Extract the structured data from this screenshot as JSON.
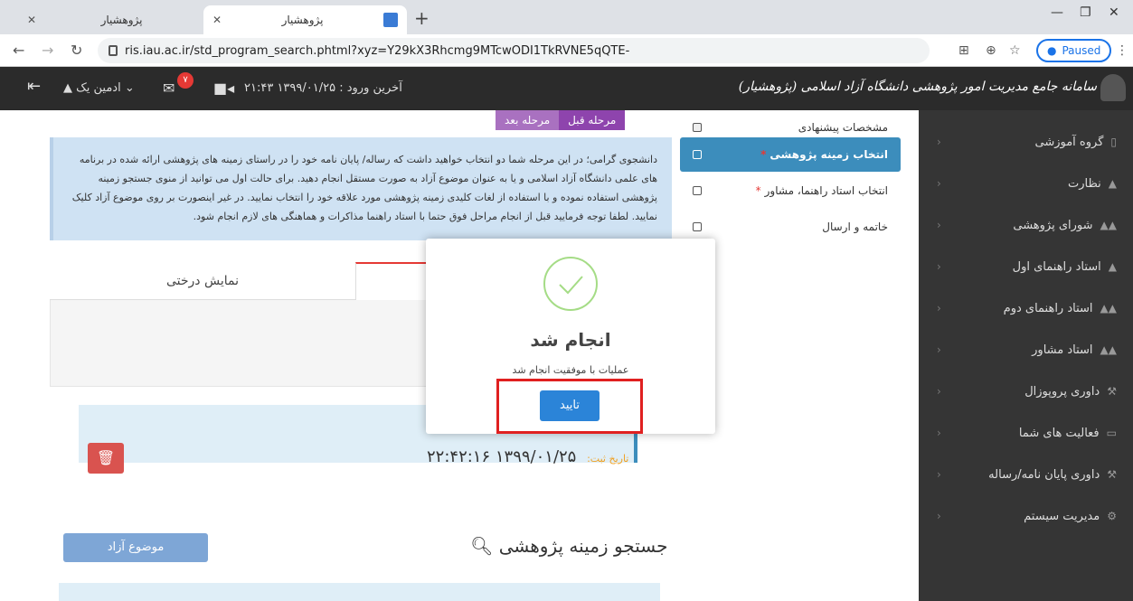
{
  "browser": {
    "tabs": [
      {
        "title": "پژوهشیار",
        "active": false
      },
      {
        "title": "پژوهشیار",
        "active": true
      }
    ],
    "url": "ris.iau.ac.ir/std_program_search.phtml?xyz=Y29kX3Rhcmg9MTcwODI1TkRVNE5qQTE-",
    "paused_label": "Paused"
  },
  "header": {
    "system_title": "سامانه جامع مدیریت امور پژوهشی دانشگاه آزاد اسلامی (پژوهشیار)",
    "last_login": "آخرین ورود : ۱۳۹۹/۰۱/۲۵ ۲۱:۴۳",
    "user_name": "ادمین یک",
    "notification_count": "۷"
  },
  "sidebar": {
    "items": [
      {
        "label": "گروه آموزشی",
        "icon": "file-icon"
      },
      {
        "label": "نظارت",
        "icon": "user-icon"
      },
      {
        "label": "شورای پژوهشی",
        "icon": "users-icon"
      },
      {
        "label": "استاد راهنمای اول",
        "icon": "user-icon"
      },
      {
        "label": "استاد راهنمای دوم",
        "icon": "users-icon"
      },
      {
        "label": "استاد مشاور",
        "icon": "users-icon"
      },
      {
        "label": "داوری پروپوزال",
        "icon": "gavel-icon"
      },
      {
        "label": "فعالیت های شما",
        "icon": "monitor-icon"
      },
      {
        "label": "داوری پایان نامه/رساله",
        "icon": "gavel-icon"
      },
      {
        "label": "مدیریت سیستم",
        "icon": "gears-icon"
      }
    ]
  },
  "steps": {
    "items": [
      {
        "label": "مشخصات پیشنهادی",
        "required": false,
        "active": false
      },
      {
        "label": "انتخاب زمینه پژوهشی",
        "required": true,
        "active": true
      },
      {
        "label": "انتخاب استاد راهنما، مشاور",
        "required": true,
        "active": false
      },
      {
        "label": "خاتمه و ارسال",
        "required": false,
        "active": false
      }
    ],
    "prev_label": "مرحله قبل",
    "next_label": "مرحله بعد"
  },
  "info": {
    "text": "دانشجوی گرامی؛ در این مرحله شما دو انتخاب خواهید داشت که رساله/ پایان نامه خود را در راستای زمینه های پژوهشی ارائه شده در برنامه های علمی دانشگاه آزاد اسلامی و یا به عنوان موضوع آزاد به صورت مستقل انجام دهید. برای حالت اول می توانید از منوی جستجو زمینه پژوهشی استفاده نموده و با استفاده از لغات کلیدی زمینه پژوهشی مورد علاقه خود را انتخاب نمایید. در غیر اینصورت بر روی موضوع آزاد کلیک نمایید. لطفا توجه فرمایید قبل از انجام مراحل فوق حتما با استاد راهنما مذاکرات و هماهنگی های لازم انجام شود."
  },
  "content_tabs": {
    "tree_label": "نمایش درختی"
  },
  "record": {
    "date_label": "تاریخ ثبت:",
    "date_value": "۱۳۹۹/۰۱/۲۵ ۲۲:۴۲:۱۶"
  },
  "search": {
    "title": "جستجو زمینه پژوهشی",
    "free_topic_label": "موضوع آزاد"
  },
  "modal": {
    "title": "انجام شد",
    "message": "عملیات با موفقیت انجام شد",
    "ok_label": "تایید"
  }
}
